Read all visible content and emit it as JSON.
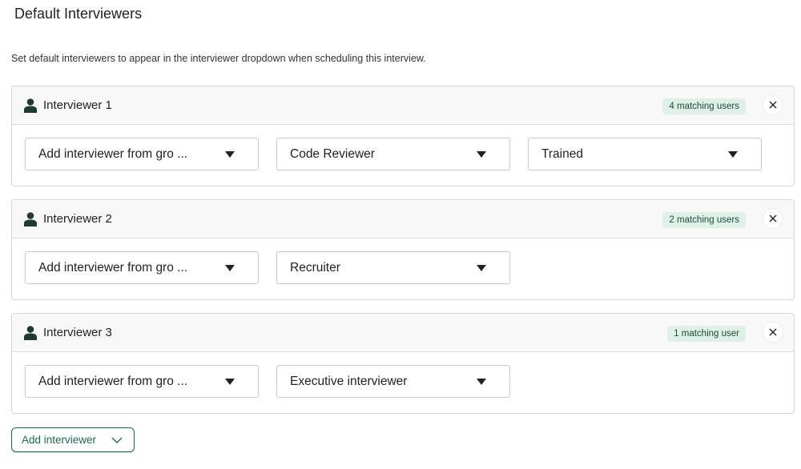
{
  "page": {
    "title": "Default Interviewers",
    "description": "Set default interviewers to appear in the interviewer dropdown when scheduling this interview."
  },
  "colors": {
    "accent": "#1d6a52",
    "badge_bg": "#dff0e8",
    "icon": "#1f3a33"
  },
  "interviewers": [
    {
      "title": "Interviewer 1",
      "badge": "4 matching users",
      "group_select": "Add interviewer from gro ...",
      "role_select": "Code Reviewer",
      "status_select": "Trained"
    },
    {
      "title": "Interviewer 2",
      "badge": "2 matching users",
      "group_select": "Add interviewer from gro ...",
      "role_select": "Recruiter"
    },
    {
      "title": "Interviewer 3",
      "badge": "1 matching user",
      "group_select": "Add interviewer from gro ...",
      "role_select": "Executive interviewer"
    }
  ],
  "add_button": {
    "label": "Add interviewer"
  }
}
